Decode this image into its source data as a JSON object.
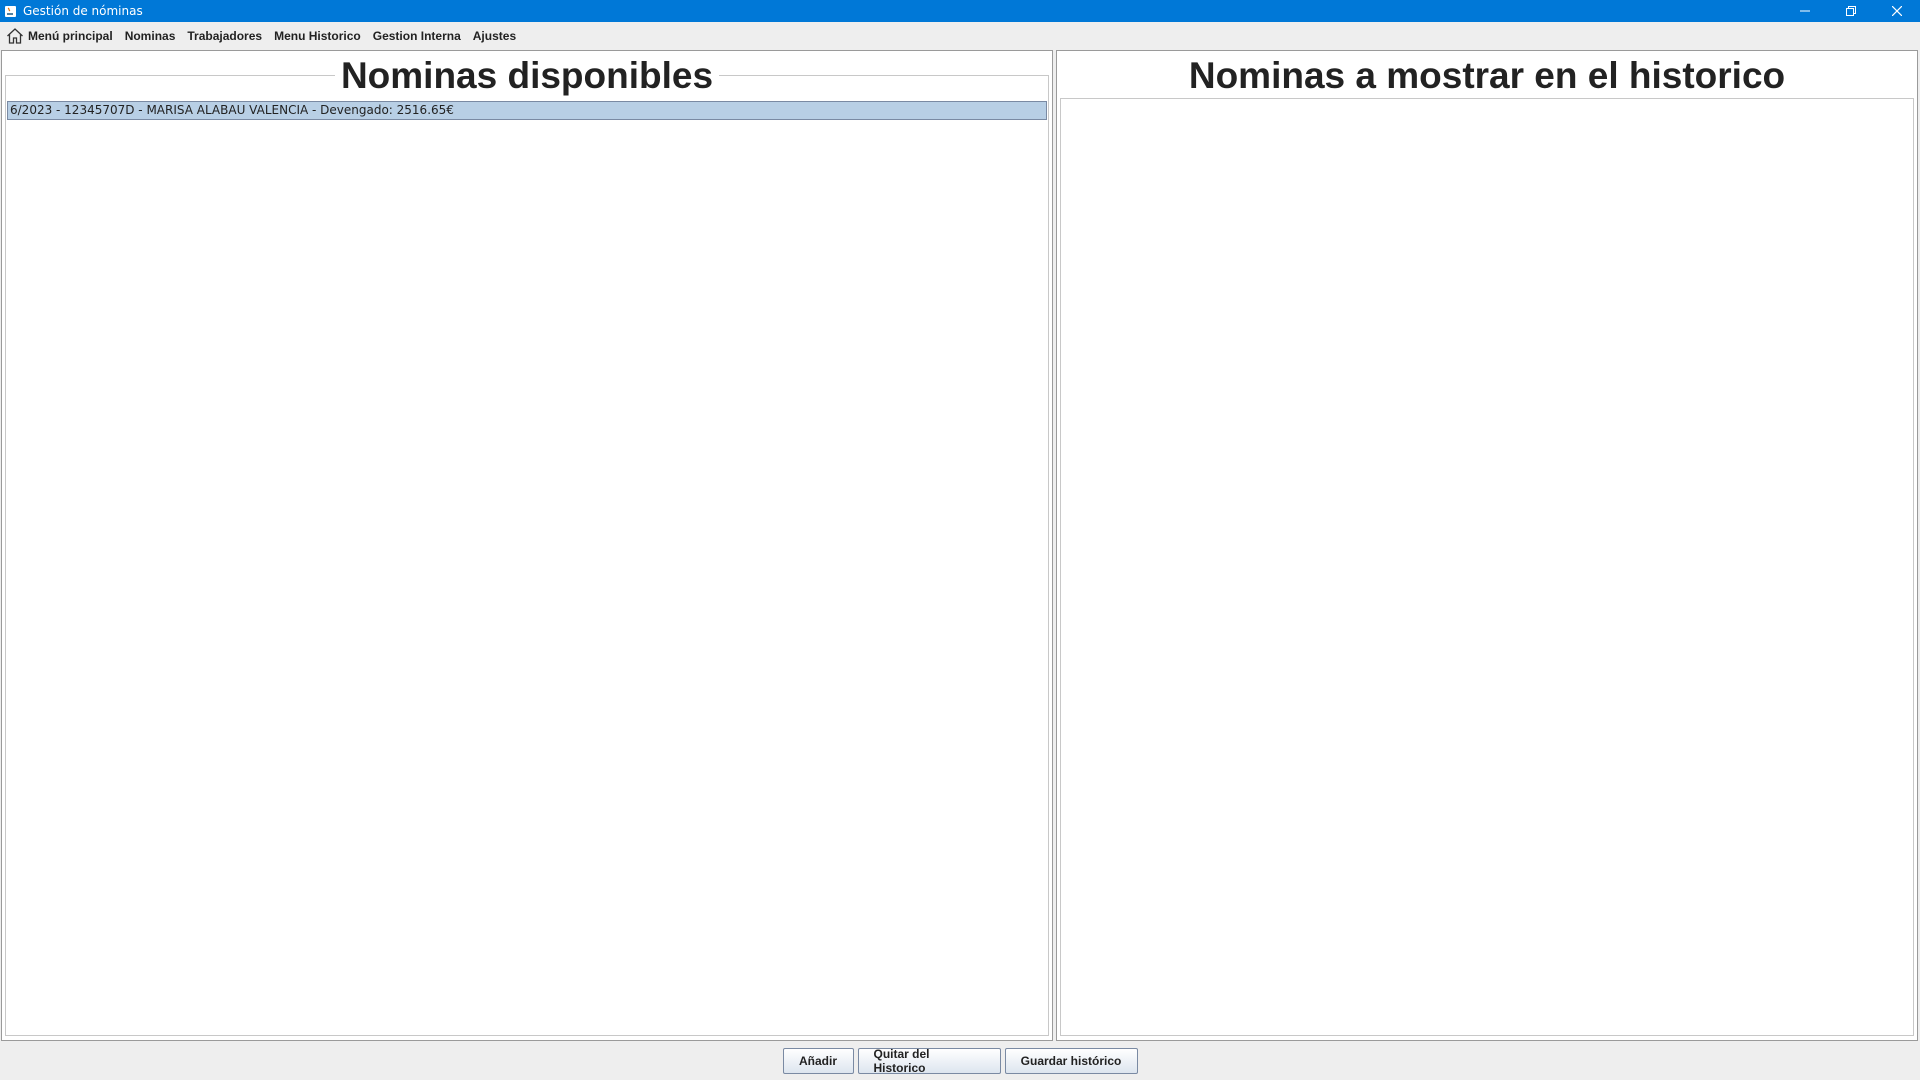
{
  "window": {
    "title": "Gestión de nóminas"
  },
  "menu": {
    "items": [
      "Menú principal",
      "Nominas",
      "Trabajadores",
      "Menu Historico",
      "Gestion Interna",
      "Ajustes"
    ]
  },
  "left_panel": {
    "title": "Nominas disponibles",
    "rows": [
      "6/2023 - 12345707D - MARISA ALABAU VALENCIA - Devengado: 2516.65€"
    ]
  },
  "right_panel": {
    "title": "Nominas a mostrar en el historico",
    "rows": []
  },
  "buttons": {
    "add": "Añadir",
    "remove": "Quitar del Historico",
    "save": "Guardar histórico"
  },
  "colors": {
    "titlebar": "#0078d7",
    "selection": "#b8cfe5"
  }
}
